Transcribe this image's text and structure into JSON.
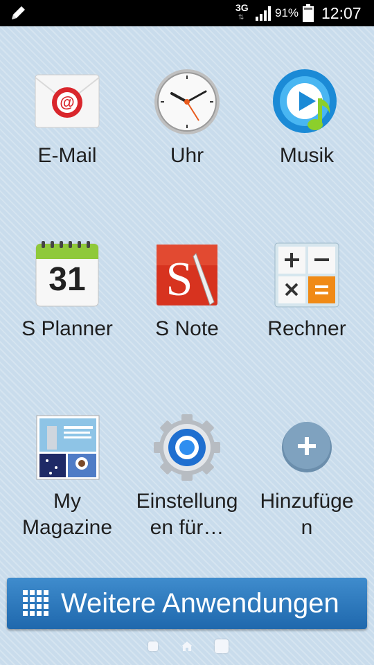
{
  "status_bar": {
    "network": "3G",
    "battery_percent": "91%",
    "time": "12:07",
    "icons": [
      "pencil-icon",
      "signal-icon",
      "battery-icon"
    ]
  },
  "apps": [
    {
      "label": "E-Mail",
      "icon": "email-icon"
    },
    {
      "label": "Uhr",
      "icon": "clock-icon"
    },
    {
      "label": "Musik",
      "icon": "music-icon"
    },
    {
      "label": "S Planner",
      "icon": "calendar-icon",
      "calendar_day": "31"
    },
    {
      "label": "S Note",
      "icon": "s-note-icon"
    },
    {
      "label": "Rechner",
      "icon": "calculator-icon"
    },
    {
      "label": "My\nMagazine",
      "icon": "magazine-icon"
    },
    {
      "label": "Einstellung\nen für…",
      "icon": "settings-icon"
    },
    {
      "label": "Hinzufüge\nn",
      "icon": "add-icon"
    }
  ],
  "more_apps": {
    "label": "Weitere Anwendungen",
    "icon": "apps-grid-icon"
  },
  "page_indicator": {
    "pages": 3,
    "current": "home"
  },
  "colors": {
    "accent_button": "#2a78bf",
    "background": "#c9dcec"
  }
}
